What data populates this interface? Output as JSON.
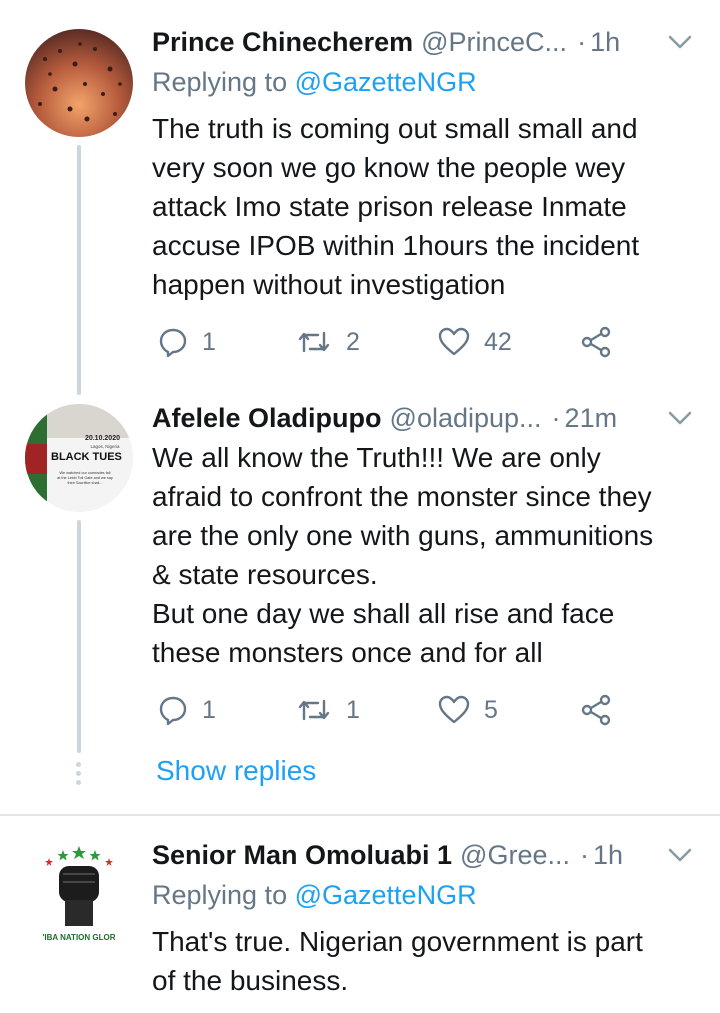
{
  "tweets": [
    {
      "name": "Prince Chinecherem",
      "handle": "@PrinceC...",
      "time": "1h",
      "replying_label": "Replying to",
      "replying_to": "@GazetteNGR",
      "lines": [
        "The truth is coming out small small and",
        "very soon we go know the people wey",
        "attack Imo state prison release Inmate",
        "accuse IPOB within 1hours the incident",
        "happen without investigation"
      ],
      "replies": "1",
      "retweets": "2",
      "likes": "42"
    },
    {
      "name": "Afelele Oladipupo",
      "handle": "@oladipup...",
      "time": "21m",
      "avatar_text": [
        "20.10.2020",
        "Lagos, Nigeria",
        "BLACK TUES",
        "We watched our comrades fall",
        "at the Lekki Toll Gate and we say",
        "their Sacrifice shall..."
      ],
      "lines": [
        "We all know the Truth!!! We are only",
        "afraid to confront the monster since they",
        "are the only one with guns, ammunitions",
        "& state resources.",
        "But one day we shall all rise and face",
        "these monsters once and for all"
      ],
      "replies": "1",
      "retweets": "1",
      "likes": "5"
    },
    {
      "name": "Senior Man Omoluabi 1",
      "handle": "@Gree...",
      "time": "1h",
      "replying_label": "Replying to",
      "replying_to": "@GazetteNGR",
      "avatar_text": "'IBA NATION GLOR",
      "lines": [
        "That's true. Nigerian government is part",
        "of the business."
      ]
    }
  ],
  "show_replies": "Show replies",
  "colors": {
    "accent": "#1da1f2",
    "secondary": "#657786",
    "text": "#14171a",
    "thread_line": "#ccd6dd",
    "divider": "#e1e8ed"
  }
}
